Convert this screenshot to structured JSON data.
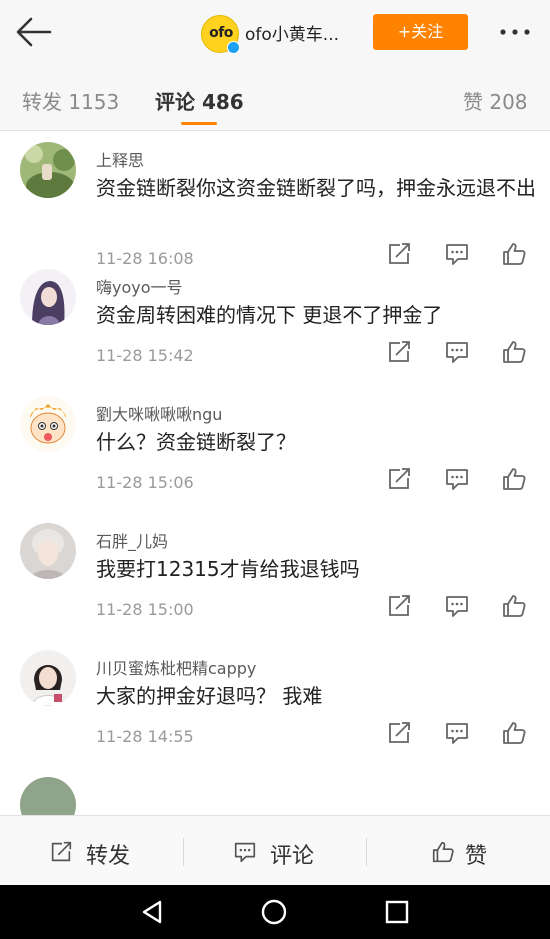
{
  "header": {
    "logo_text": "ofo",
    "title": "ofo小黄车...",
    "follow_label": "+关注",
    "colors": {
      "accent": "#ff8200",
      "logo": "#ffd21f",
      "verified": "#1da1f2"
    }
  },
  "tabs": [
    {
      "label": "转发",
      "count": "1153"
    },
    {
      "label": "评论",
      "count": "486",
      "active": true
    },
    {
      "label": "赞",
      "count": "208"
    }
  ],
  "comments": [
    {
      "username": "上释思",
      "text": "资金链断裂你这资金链断裂了吗，押金永远退不出",
      "time": "11-28 16:08",
      "avatar_icon": "landscape-photo-avatar"
    },
    {
      "username": "嗨yoyo一号",
      "text": "资金周转困难的情况下 更退不了押金了",
      "time": "11-28 15:42",
      "avatar_icon": "anime-girl-avatar"
    },
    {
      "username": "劉大咪啾啾啾ngu",
      "text": "什么？资金链断裂了？",
      "time": "11-28 15:06",
      "avatar_icon": "cartoon-kid-avatar"
    },
    {
      "username": "石胖_儿妈",
      "text": "我要打12315才肯给我退钱吗",
      "time": "11-28 15:00",
      "avatar_icon": "portrait-photo-avatar"
    },
    {
      "username": "川贝蜜炼枇杷精cappy",
      "text": "大家的押金好退吗？ 我难",
      "time": "11-28 14:55",
      "avatar_icon": "girl-photo-avatar"
    }
  ],
  "bottom_bar": {
    "repost_label": "转发",
    "comment_label": "评论",
    "like_label": "赞"
  },
  "icons": [
    "back-arrow-icon",
    "more-dots-icon",
    "repost-icon",
    "comment-icon",
    "like-icon",
    "nav-back-icon",
    "nav-home-icon",
    "nav-recent-icon"
  ]
}
